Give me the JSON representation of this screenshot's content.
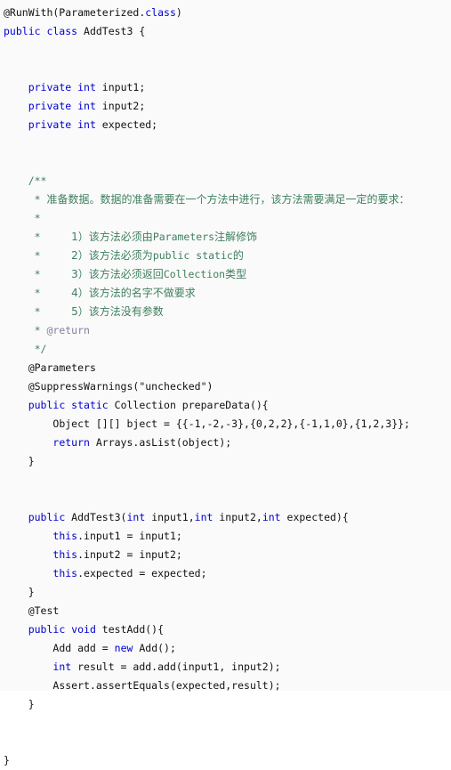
{
  "editor": {
    "language": "Java",
    "background_color": "#fafafa",
    "default_text_color": "#111111",
    "keyword_color": "#0000D0",
    "comment_color": "#3F7F5F",
    "javadoc_tag_color": "#7F7F9F",
    "class_name": "AddTest3"
  },
  "code": {
    "lines": [
      {
        "id": "l1",
        "indent": 0,
        "tokens": [
          {
            "t": "@RunWith(Parameterized.",
            "c": "plain"
          },
          {
            "t": "class",
            "c": "kw"
          },
          {
            "t": ")",
            "c": "plain"
          }
        ]
      },
      {
        "id": "l2",
        "indent": 0,
        "tokens": [
          {
            "t": "public class ",
            "c": "kw"
          },
          {
            "t": "AddTest3 {",
            "c": "plain"
          }
        ]
      },
      {
        "id": "l3",
        "indent": 0,
        "tokens": []
      },
      {
        "id": "l4",
        "indent": 0,
        "tokens": []
      },
      {
        "id": "l5",
        "indent": 1,
        "tokens": [
          {
            "t": "private int ",
            "c": "kw"
          },
          {
            "t": "input1;",
            "c": "plain"
          }
        ]
      },
      {
        "id": "l6",
        "indent": 1,
        "tokens": [
          {
            "t": "private int ",
            "c": "kw"
          },
          {
            "t": "input2;",
            "c": "plain"
          }
        ]
      },
      {
        "id": "l7",
        "indent": 1,
        "tokens": [
          {
            "t": "private int ",
            "c": "kw"
          },
          {
            "t": "expected;",
            "c": "plain"
          }
        ]
      },
      {
        "id": "l8",
        "indent": 0,
        "tokens": []
      },
      {
        "id": "l9",
        "indent": 0,
        "tokens": []
      },
      {
        "id": "l10",
        "indent": 1,
        "tokens": [
          {
            "t": "/**",
            "c": "comment"
          }
        ]
      },
      {
        "id": "l11",
        "indent": 1,
        "tokens": [
          {
            "t": " * ",
            "c": "comment"
          },
          {
            "t": "准备数据。数据的准备需要在一个方法中进行，该方法需要满足一定的要求：",
            "c": "cjk"
          }
        ]
      },
      {
        "id": "l12",
        "indent": 1,
        "tokens": [
          {
            "t": " * ",
            "c": "comment"
          }
        ]
      },
      {
        "id": "l13",
        "indent": 1,
        "tokens": [
          {
            "t": " *     ",
            "c": "comment"
          },
          {
            "t": "1）该方法必须由",
            "c": "cjk"
          },
          {
            "t": "Parameters",
            "c": "cjk-mono"
          },
          {
            "t": "注解修饰",
            "c": "cjk"
          }
        ]
      },
      {
        "id": "l14",
        "indent": 1,
        "tokens": [
          {
            "t": " *     ",
            "c": "comment"
          },
          {
            "t": "2）该方法必须为",
            "c": "cjk"
          },
          {
            "t": "public static",
            "c": "cjk-mono"
          },
          {
            "t": "的",
            "c": "cjk"
          }
        ]
      },
      {
        "id": "l15",
        "indent": 1,
        "tokens": [
          {
            "t": " *     ",
            "c": "comment"
          },
          {
            "t": "3）该方法必须返回",
            "c": "cjk"
          },
          {
            "t": "Collection",
            "c": "cjk-mono"
          },
          {
            "t": "类型",
            "c": "cjk"
          }
        ]
      },
      {
        "id": "l16",
        "indent": 1,
        "tokens": [
          {
            "t": " *     ",
            "c": "comment"
          },
          {
            "t": "4）该方法的名字不做要求",
            "c": "cjk"
          }
        ]
      },
      {
        "id": "l17",
        "indent": 1,
        "tokens": [
          {
            "t": " *     ",
            "c": "comment"
          },
          {
            "t": "5）该方法没有参数",
            "c": "cjk"
          }
        ]
      },
      {
        "id": "l18",
        "indent": 1,
        "tokens": [
          {
            "t": " * ",
            "c": "comment"
          },
          {
            "t": "@return",
            "c": "doctag"
          }
        ]
      },
      {
        "id": "l19",
        "indent": 1,
        "tokens": [
          {
            "t": " */",
            "c": "comment"
          }
        ]
      },
      {
        "id": "l20",
        "indent": 1,
        "tokens": [
          {
            "t": "@Parameters",
            "c": "anno"
          }
        ]
      },
      {
        "id": "l21",
        "indent": 1,
        "tokens": [
          {
            "t": "@SuppressWarnings(\"unchecked\")",
            "c": "anno"
          }
        ]
      },
      {
        "id": "l22",
        "indent": 1,
        "tokens": [
          {
            "t": "public static ",
            "c": "kw"
          },
          {
            "t": "Collection prepareData(){",
            "c": "plain"
          }
        ]
      },
      {
        "id": "l23",
        "indent": 2,
        "tokens": [
          {
            "t": "Object [][] bject = {{-1,-2,-3},{0,2,2},{-1,1,0},{1,2,3}};",
            "c": "plain"
          }
        ]
      },
      {
        "id": "l24",
        "indent": 2,
        "tokens": [
          {
            "t": "return ",
            "c": "kw"
          },
          {
            "t": "Arrays.asList(object);",
            "c": "plain"
          }
        ]
      },
      {
        "id": "l25",
        "indent": 1,
        "tokens": [
          {
            "t": "}",
            "c": "plain"
          }
        ]
      },
      {
        "id": "l26",
        "indent": 0,
        "tokens": []
      },
      {
        "id": "l27",
        "indent": 0,
        "tokens": []
      },
      {
        "id": "l28",
        "indent": 1,
        "tokens": [
          {
            "t": "public ",
            "c": "kw"
          },
          {
            "t": "AddTest3(",
            "c": "plain"
          },
          {
            "t": "int ",
            "c": "kw"
          },
          {
            "t": "input1,",
            "c": "plain"
          },
          {
            "t": "int ",
            "c": "kw"
          },
          {
            "t": "input2,",
            "c": "plain"
          },
          {
            "t": "int ",
            "c": "kw"
          },
          {
            "t": "expected){",
            "c": "plain"
          }
        ]
      },
      {
        "id": "l29",
        "indent": 2,
        "tokens": [
          {
            "t": "this",
            "c": "kw"
          },
          {
            "t": ".input1 = input1;",
            "c": "plain"
          }
        ]
      },
      {
        "id": "l30",
        "indent": 2,
        "tokens": [
          {
            "t": "this",
            "c": "kw"
          },
          {
            "t": ".input2 = input2;",
            "c": "plain"
          }
        ]
      },
      {
        "id": "l31",
        "indent": 2,
        "tokens": [
          {
            "t": "this",
            "c": "kw"
          },
          {
            "t": ".expected = expected;",
            "c": "plain"
          }
        ]
      },
      {
        "id": "l32",
        "indent": 1,
        "tokens": [
          {
            "t": "}",
            "c": "plain"
          }
        ]
      },
      {
        "id": "l33",
        "indent": 1,
        "tokens": [
          {
            "t": "@Test",
            "c": "anno"
          }
        ]
      },
      {
        "id": "l34",
        "indent": 1,
        "tokens": [
          {
            "t": "public void ",
            "c": "kw"
          },
          {
            "t": "testAdd(){",
            "c": "plain"
          }
        ]
      },
      {
        "id": "l35",
        "indent": 2,
        "tokens": [
          {
            "t": "Add add = ",
            "c": "plain"
          },
          {
            "t": "new ",
            "c": "kw"
          },
          {
            "t": "Add();",
            "c": "plain"
          }
        ]
      },
      {
        "id": "l36",
        "indent": 2,
        "tokens": [
          {
            "t": "int ",
            "c": "kw"
          },
          {
            "t": "result = add.add(input1, input2);",
            "c": "plain"
          }
        ]
      },
      {
        "id": "l37",
        "indent": 2,
        "tokens": [
          {
            "t": "Assert.assertEquals(expected,result);",
            "c": "plain"
          }
        ]
      },
      {
        "id": "l38",
        "indent": 1,
        "tokens": [
          {
            "t": "}",
            "c": "plain"
          }
        ]
      },
      {
        "id": "l39",
        "indent": 0,
        "tokens": []
      },
      {
        "id": "l40",
        "indent": 0,
        "tokens": []
      },
      {
        "id": "l41",
        "indent": 0,
        "tokens": [
          {
            "t": "}",
            "c": "plain"
          }
        ]
      }
    ]
  }
}
